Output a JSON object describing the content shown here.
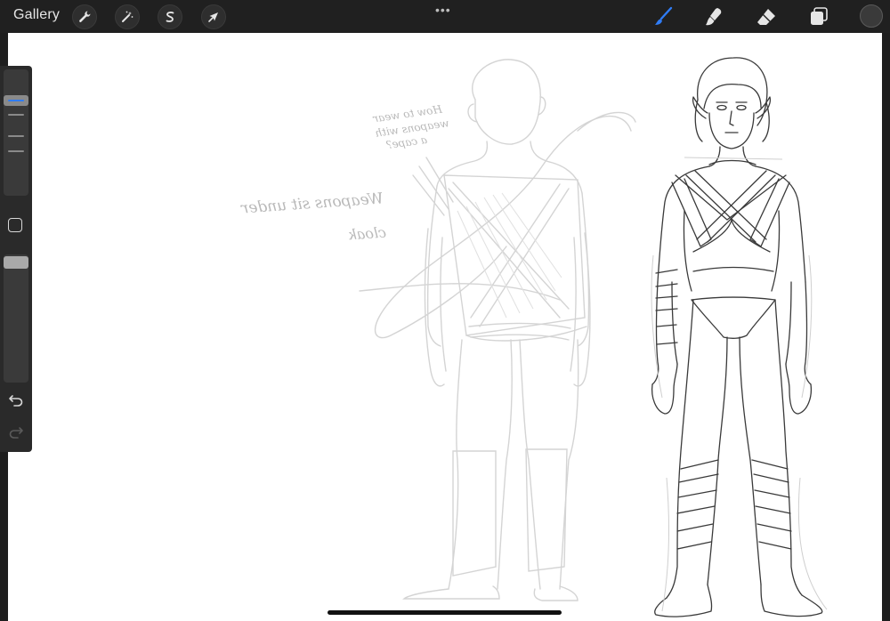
{
  "app": {
    "gallery_label": "Gallery",
    "more_menu": "•••",
    "accent_color": "#2f7cf6"
  },
  "toolbar": {
    "left_tools": [
      {
        "name": "actions",
        "icon": "wrench-icon"
      },
      {
        "name": "adjustments",
        "icon": "magic-wand-icon"
      },
      {
        "name": "selection",
        "icon": "selection-s-icon"
      },
      {
        "name": "transform",
        "icon": "arrow-cursor-icon"
      }
    ],
    "right_tools": [
      {
        "name": "brush",
        "icon": "brush-icon",
        "active": true
      },
      {
        "name": "smudge",
        "icon": "smudge-icon",
        "active": false
      },
      {
        "name": "eraser",
        "icon": "eraser-icon",
        "active": false
      },
      {
        "name": "layers",
        "icon": "layers-icon",
        "active": false
      }
    ],
    "current_color": "#3a3a3a"
  },
  "sidebar": {
    "brush_size_level": 0.78,
    "opacity_level": 1.0
  },
  "canvas": {
    "notes": {
      "line1": "How to wear",
      "line2": "weapons with",
      "line3": "a cape?",
      "line4": "Weapons sit under",
      "line5": "cloak"
    }
  }
}
